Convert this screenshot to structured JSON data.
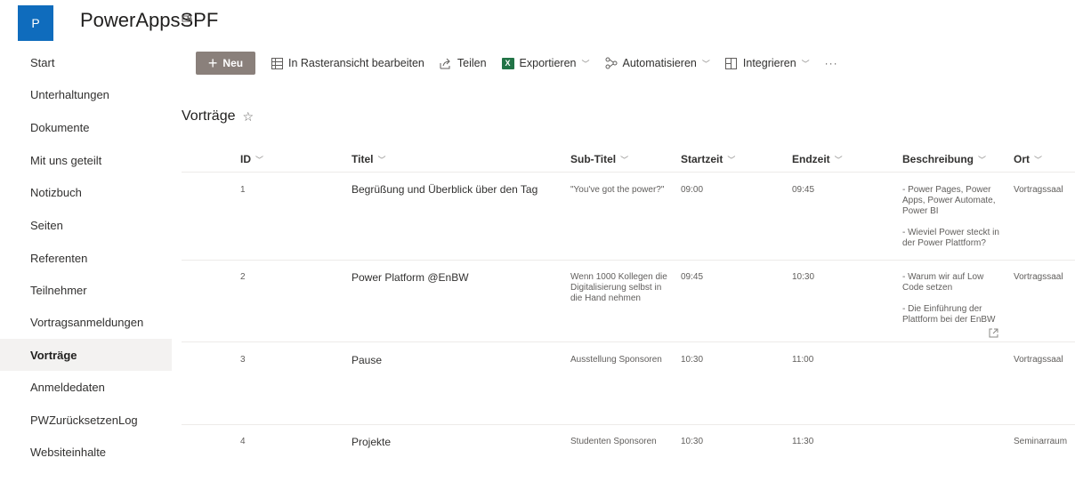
{
  "site": {
    "logo_letter": "P",
    "title": "PowerAppsSPF",
    "teams_icon": "teams-icon"
  },
  "nav": {
    "items": [
      {
        "label": "Start"
      },
      {
        "label": "Unterhaltungen"
      },
      {
        "label": "Dokumente"
      },
      {
        "label": "Mit uns geteilt"
      },
      {
        "label": "Notizbuch"
      },
      {
        "label": "Seiten"
      },
      {
        "label": "Referenten"
      },
      {
        "label": "Teilnehmer"
      },
      {
        "label": "Vortragsanmeldungen"
      },
      {
        "label": "Vorträge",
        "selected": true
      },
      {
        "label": "Anmeldedaten"
      },
      {
        "label": "PWZurücksetzenLog"
      },
      {
        "label": "Websiteinhalte"
      }
    ]
  },
  "toolbar": {
    "new_label": "Neu",
    "grid_label": "In Rasteransicht bearbeiten",
    "share_label": "Teilen",
    "export_label": "Exportieren",
    "automate_label": "Automatisieren",
    "integrate_label": "Integrieren",
    "more_label": "···",
    "excel_glyph": "X"
  },
  "list": {
    "title": "Vorträge",
    "columns": {
      "id": "ID",
      "titel": "Titel",
      "subtitel": "Sub-Titel",
      "start": "Startzeit",
      "end": "Endzeit",
      "desc": "Beschreibung",
      "ort": "Ort"
    },
    "rows": [
      {
        "id": "1",
        "titel": "Begrüßung und Überblick über den Tag",
        "subtitel": "\"You've got the power?\"",
        "start": "09:00",
        "end": "09:45",
        "desc1": "- Power Pages, Power Apps, Power Automate, Power BI",
        "desc2": "- Wieviel Power steckt in der Power Plattform?",
        "ort": "Vortragssaal"
      },
      {
        "id": "2",
        "titel": "Power Platform @EnBW",
        "subtitel": "Wenn 1000 Kollegen die Digitalisierung selbst in die Hand nehmen",
        "start": "09:45",
        "end": "10:30",
        "desc1": "- Warum wir auf Low Code setzen",
        "desc2": "- Die Einführung der Plattform bei der EnBW",
        "ort": "Vortragssaal"
      },
      {
        "id": "3",
        "titel": "Pause",
        "subtitel": "Ausstellung Sponsoren",
        "start": "10:30",
        "end": "11:00",
        "desc1": "",
        "desc2": "",
        "ort": "Vortragssaal"
      },
      {
        "id": "4",
        "titel": "Projekte",
        "subtitel": "Studenten Sponsoren",
        "start": "10:30",
        "end": "11:30",
        "desc1": "",
        "desc2": "",
        "ort": "Seminarraum"
      }
    ]
  }
}
